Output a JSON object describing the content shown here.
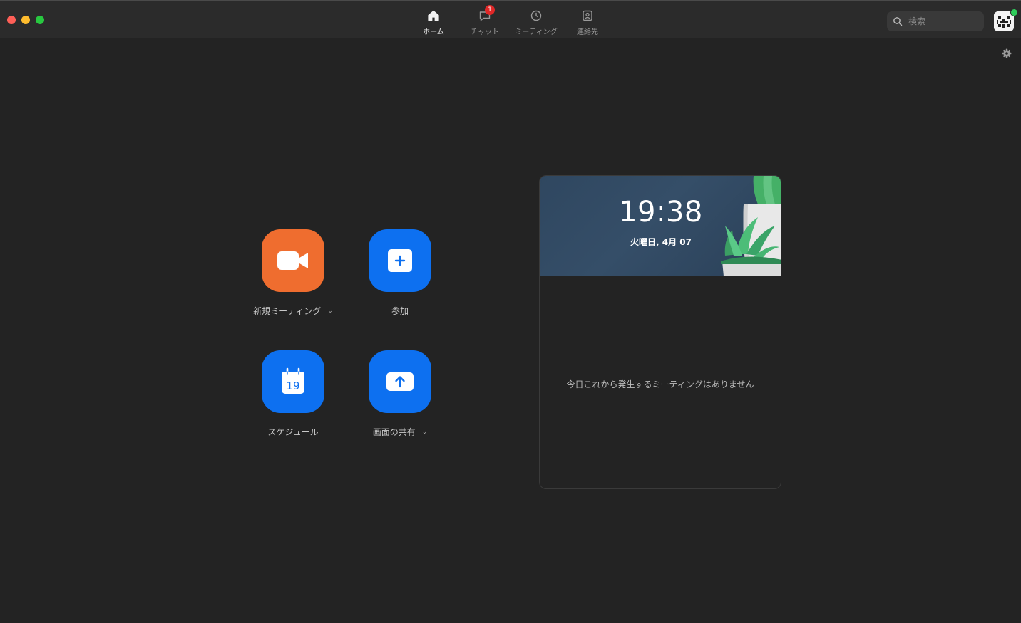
{
  "nav": {
    "tabs": [
      {
        "label": "ホーム",
        "icon": "home-icon",
        "active": true
      },
      {
        "label": "チャット",
        "icon": "chat-icon",
        "badge": "1"
      },
      {
        "label": "ミーティング",
        "icon": "clock-icon"
      },
      {
        "label": "連絡先",
        "icon": "contacts-icon"
      }
    ]
  },
  "search": {
    "placeholder": "検索"
  },
  "actions": {
    "new_meeting": {
      "label": "新規ミーティング",
      "icon": "video-camera-icon",
      "color": "#ef6d2f"
    },
    "join": {
      "label": "参加",
      "icon": "plus-icon",
      "color": "#0d70f0"
    },
    "schedule": {
      "label": "スケジュール",
      "icon": "calendar-icon",
      "calendar_day": "19",
      "color": "#0d70f0"
    },
    "share": {
      "label": "画面の共有",
      "icon": "share-screen-icon",
      "color": "#0d70f0"
    }
  },
  "calendar": {
    "time": "19:38",
    "date": "火曜日, 4月 07",
    "empty_message": "今日これから発生するミーティングはありません"
  },
  "colors": {
    "background": "#232323",
    "titlebar": "#2b2b2b",
    "accent_blue": "#0d70f0",
    "accent_orange": "#ef6d2f",
    "badge_red": "#e02828",
    "online_green": "#2fcc5a"
  }
}
